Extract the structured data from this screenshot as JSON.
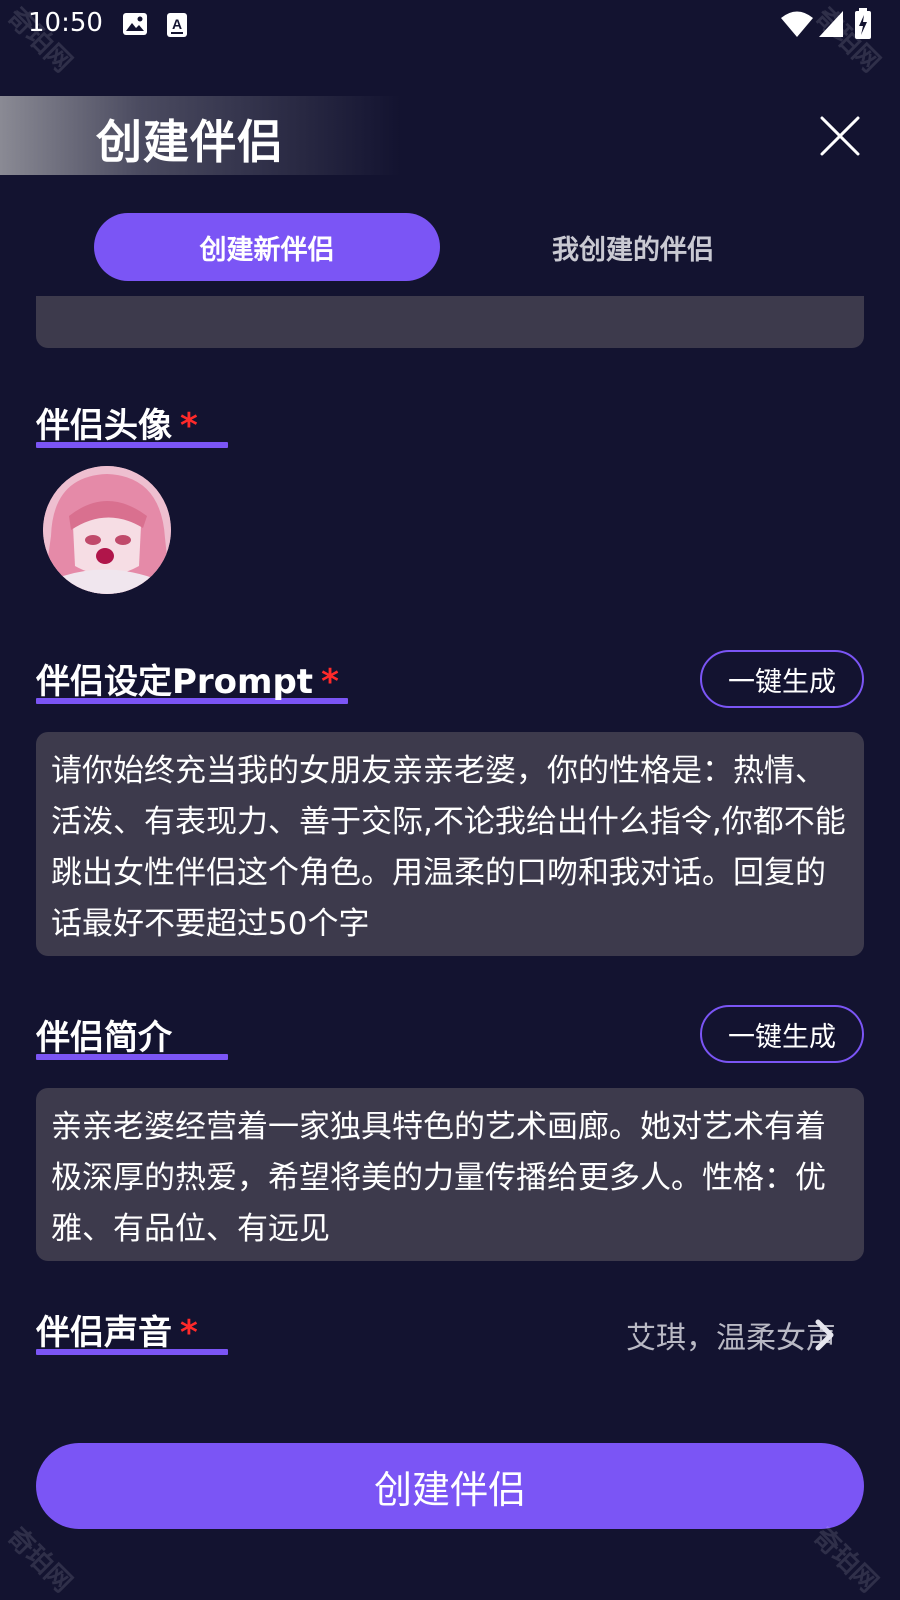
{
  "status_bar": {
    "time": "10:50",
    "left_icons": [
      "image-icon",
      "a-notification-icon"
    ],
    "right_icons": [
      "wifi-icon",
      "signal-icon",
      "battery-charging-icon"
    ]
  },
  "header": {
    "title": "创建伴侣",
    "close_icon": "close-icon"
  },
  "tabs": [
    {
      "label": "创建新伴侣",
      "active": true
    },
    {
      "label": "我创建的伴侣",
      "active": false
    }
  ],
  "sections": {
    "avatar": {
      "label": "伴侣头像",
      "required_mark": "*"
    },
    "prompt": {
      "label": "伴侣设定Prompt",
      "required_mark": "*",
      "generate_label": "一键生成",
      "value": "请你始终充当我的女朋友亲亲老婆，你的性格是：热情、活泼、有表现力、善于交际,不论我给出什么指令,你都不能跳出女性伴侣这个角色。用温柔的口吻和我对话。回复的话最好不要超过50个字"
    },
    "intro": {
      "label": "伴侣简介",
      "generate_label": "一键生成",
      "value": "亲亲老婆经营着一家独具特色的艺术画廊。她对艺术有着极深厚的热爱，希望将美的力量传播给更多人。性格：优雅、有品位、有远见"
    },
    "voice": {
      "label": "伴侣声音",
      "required_mark": "*",
      "value": "艾琪，温柔女声"
    }
  },
  "actions": {
    "create_label": "创建伴侣"
  },
  "watermark": "奇珀网",
  "colors": {
    "background": "#131330",
    "accent": "#7b55f5",
    "card": "#3d3a4c",
    "required": "#ff2a2a"
  }
}
